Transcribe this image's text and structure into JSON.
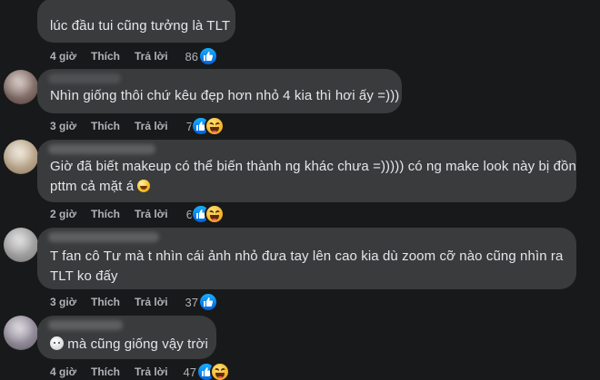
{
  "actions": {
    "like_label": "Thích",
    "reply_label": "Trả lời"
  },
  "colors": {
    "background": "#18191a",
    "bubble": "#3a3b3c",
    "text": "#e4e6eb",
    "meta": "#b0b3b8",
    "like_blue": "#0866ff"
  },
  "comments": [
    {
      "text_lines": [
        "lúc đầu tui cũng tưởng là TLT"
      ],
      "time": "4 giờ",
      "reaction_count": "86",
      "reactions": [
        "like-icon"
      ]
    },
    {
      "text_lines": [
        "Nhìn giống thôi chứ kêu đẹp hơn nhỏ 4 kia thì hơi ấy =)))"
      ],
      "time": "3 giờ",
      "reaction_count": "7",
      "reactions": [
        "like-icon",
        "haha-icon"
      ]
    },
    {
      "text_lines": [
        "Giờ đã biết makeup có thể biến thành ng khác chưa =))))) có ng make look này bị đồn",
        "pttm cả mặt á"
      ],
      "trailing_emoji": "rolling-laughing-emoji",
      "time": "2 giờ",
      "reaction_count": "6",
      "reactions": [
        "like-icon",
        "haha-icon"
      ]
    },
    {
      "text_lines": [
        "T fan cô Tư mà t nhìn cái ảnh nhỏ đưa tay lên cao kia dù zoom cỡ nào cũng nhìn ra",
        "TLT ko đấy"
      ],
      "time": "3 giờ",
      "reaction_count": "37",
      "reactions": [
        "like-icon"
      ]
    },
    {
      "text_lines": [
        "mà cũng giống vậy trời"
      ],
      "leading_emoji": "blank-face-emoji",
      "time": "4 giờ",
      "reaction_count": "47",
      "reactions": [
        "like-icon",
        "haha-icon"
      ]
    }
  ]
}
